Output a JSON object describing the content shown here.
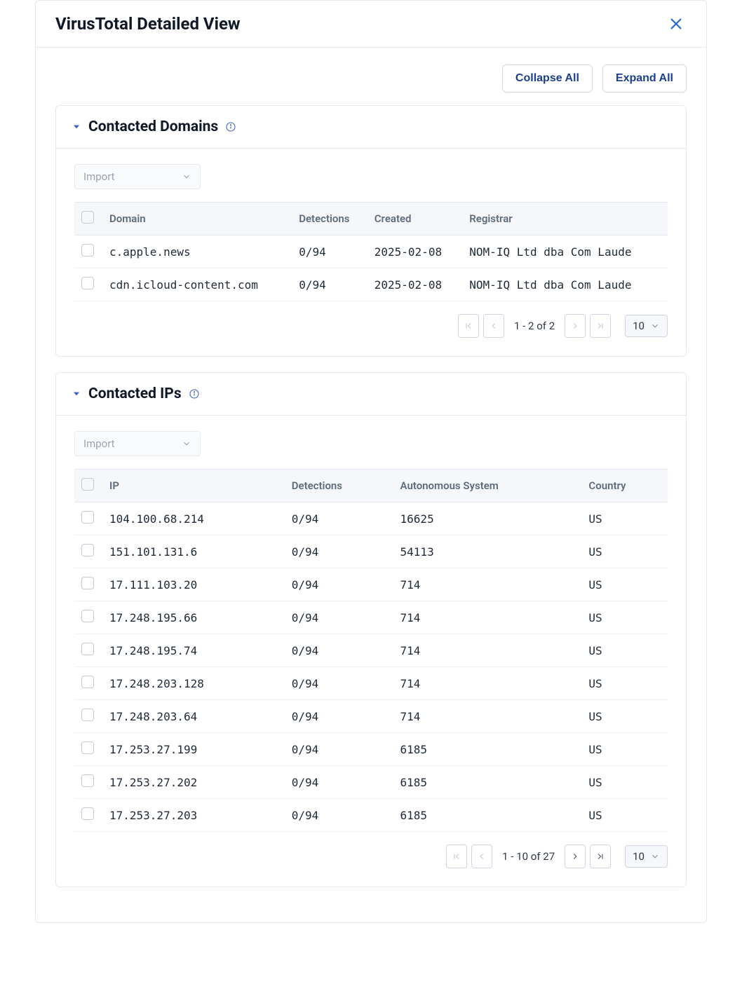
{
  "modal": {
    "title": "VirusTotal Detailed View"
  },
  "toolbar": {
    "collapse_label": "Collapse All",
    "expand_label": "Expand All"
  },
  "import_placeholder": "Import",
  "domains_panel": {
    "title": "Contacted Domains",
    "columns": {
      "domain": "Domain",
      "detections": "Detections",
      "created": "Created",
      "registrar": "Registrar"
    },
    "rows": [
      {
        "domain": "c.apple.news",
        "detections": "0/94",
        "created": "2025-02-08",
        "registrar": "NOM-IQ Ltd dba Com Laude"
      },
      {
        "domain": "cdn.icloud-content.com",
        "detections": "0/94",
        "created": "2025-02-08",
        "registrar": "NOM-IQ Ltd dba Com Laude"
      }
    ],
    "pager": {
      "range": "1 - 2 of 2",
      "page_size": "10"
    }
  },
  "ips_panel": {
    "title": "Contacted IPs",
    "columns": {
      "ip": "IP",
      "detections": "Detections",
      "asn": "Autonomous System",
      "country": "Country"
    },
    "rows": [
      {
        "ip": "104.100.68.214",
        "detections": "0/94",
        "asn": "16625",
        "country": "US"
      },
      {
        "ip": "151.101.131.6",
        "detections": "0/94",
        "asn": "54113",
        "country": "US"
      },
      {
        "ip": "17.111.103.20",
        "detections": "0/94",
        "asn": "714",
        "country": "US"
      },
      {
        "ip": "17.248.195.66",
        "detections": "0/94",
        "asn": "714",
        "country": "US"
      },
      {
        "ip": "17.248.195.74",
        "detections": "0/94",
        "asn": "714",
        "country": "US"
      },
      {
        "ip": "17.248.203.128",
        "detections": "0/94",
        "asn": "714",
        "country": "US"
      },
      {
        "ip": "17.248.203.64",
        "detections": "0/94",
        "asn": "714",
        "country": "US"
      },
      {
        "ip": "17.253.27.199",
        "detections": "0/94",
        "asn": "6185",
        "country": "US"
      },
      {
        "ip": "17.253.27.202",
        "detections": "0/94",
        "asn": "6185",
        "country": "US"
      },
      {
        "ip": "17.253.27.203",
        "detections": "0/94",
        "asn": "6185",
        "country": "US"
      }
    ],
    "pager": {
      "range": "1 - 10 of 27",
      "page_size": "10"
    }
  }
}
